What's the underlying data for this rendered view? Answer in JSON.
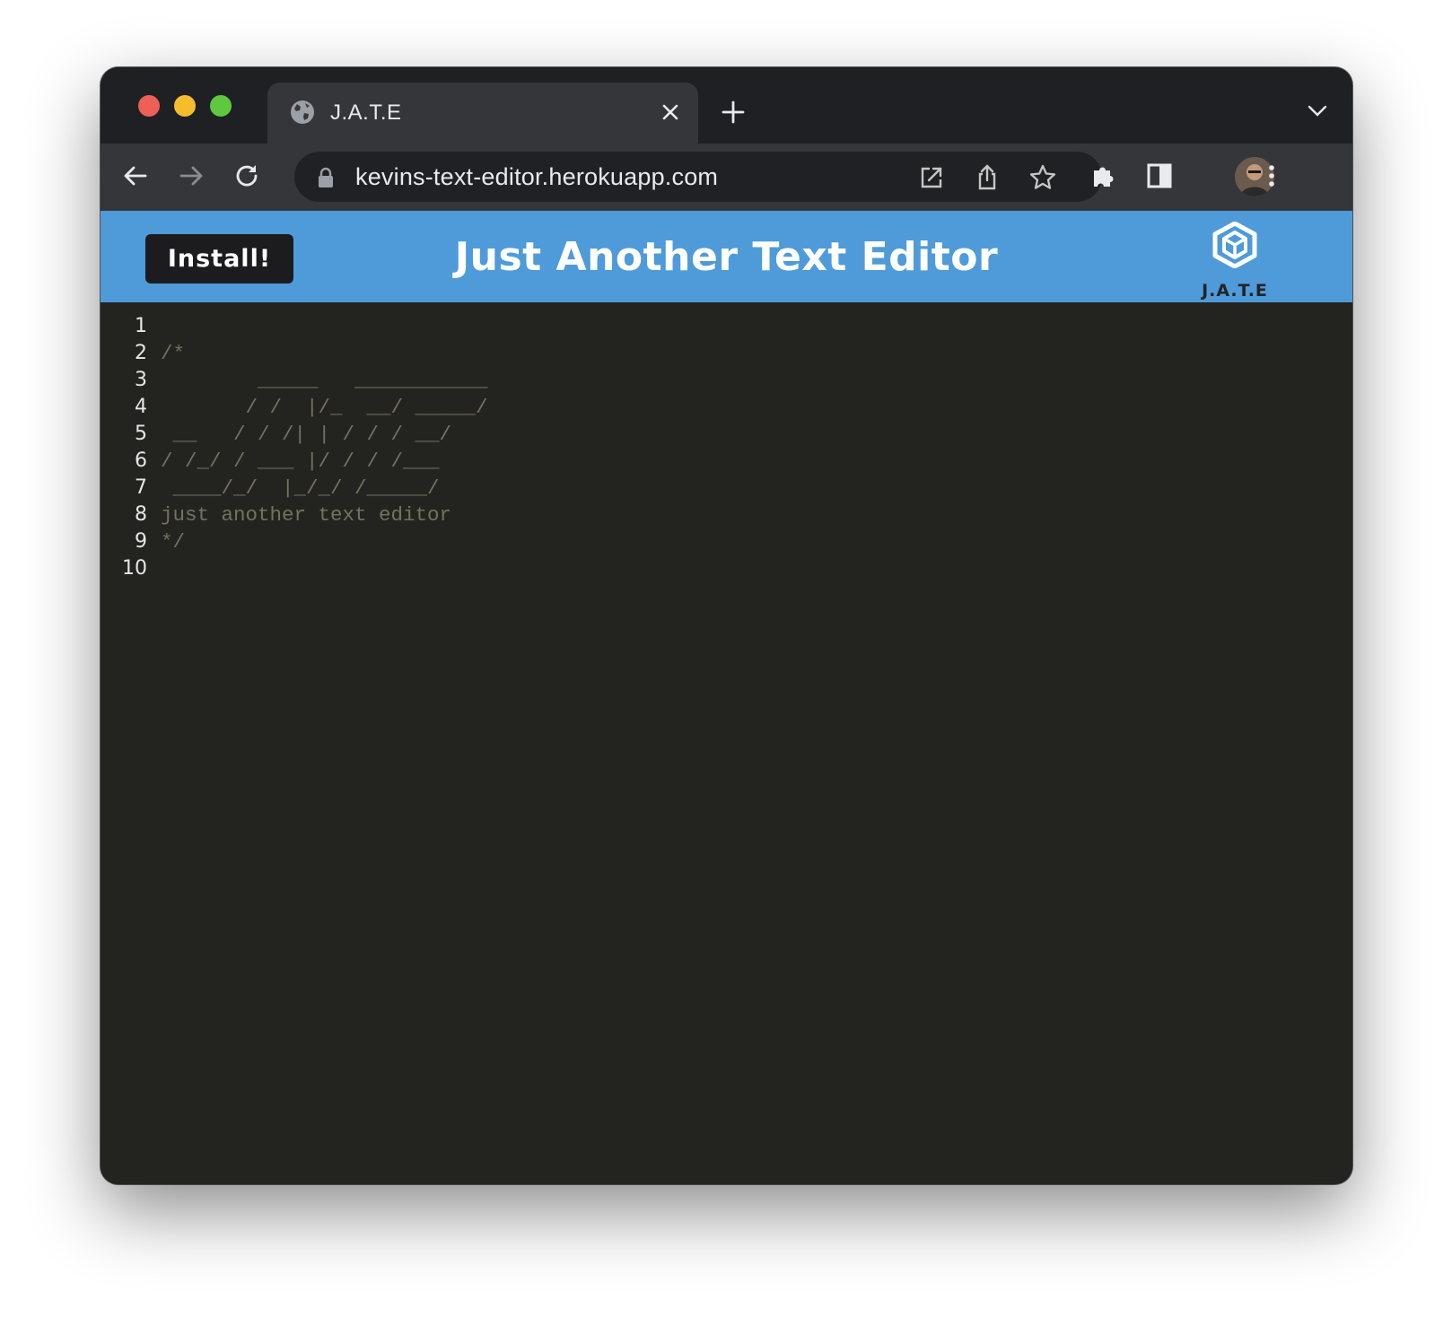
{
  "browser": {
    "tab": {
      "title": "J.A.T.E"
    },
    "url": "kevins-text-editor.herokuapp.com"
  },
  "app": {
    "install_label": "Install!",
    "title": "Just Another Text Editor",
    "logo_text": "J.A.T.E",
    "brand_color": "#4f9bda"
  },
  "editor": {
    "line_numbers": [
      "1",
      "2",
      "3",
      "4",
      "5",
      "6",
      "7",
      "8",
      "9",
      "10"
    ],
    "lines": [
      "",
      "/*",
      "        _____   ___________",
      "       / /  |/_  __/ _____/",
      " __   / / /| | / / / __/",
      "/ /_/ / ___ |/ / / /___",
      " ____/_/  |_/_/ /_____/",
      "just another text editor",
      "*/",
      ""
    ],
    "comment_color": "#75715e"
  }
}
